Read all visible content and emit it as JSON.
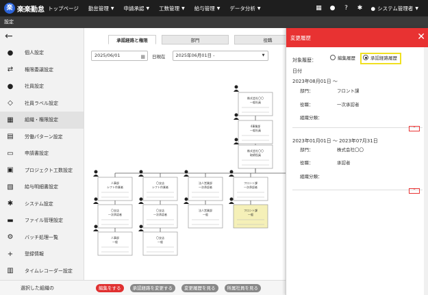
{
  "app": {
    "logo_mark": "楽",
    "logo_text": "楽楽勤怠",
    "menu": [
      {
        "label": "トップページ",
        "has_dropdown": false
      },
      {
        "label": "勤怠管理",
        "has_dropdown": true
      },
      {
        "label": "申請承認",
        "has_dropdown": true
      },
      {
        "label": "工数管理",
        "has_dropdown": true
      },
      {
        "label": "給与管理",
        "has_dropdown": true
      },
      {
        "label": "データ分析",
        "has_dropdown": true
      }
    ],
    "user_label": "システム管理者"
  },
  "subbar": {
    "title": "設定"
  },
  "sidebar": {
    "items": [
      {
        "label": "個人設定",
        "icon": "person-icon",
        "glyph": "●"
      },
      {
        "label": "権限委譲設定",
        "icon": "transfer-icon",
        "glyph": "⇄"
      },
      {
        "label": "社員設定",
        "icon": "users-icon",
        "glyph": "●"
      },
      {
        "label": "社員ラベル設定",
        "icon": "tag-icon",
        "glyph": "◇"
      },
      {
        "label": "組織・権限設定",
        "icon": "org-icon",
        "glyph": "▦",
        "active": true
      },
      {
        "label": "労働パターン設定",
        "icon": "list-icon",
        "glyph": "▤"
      },
      {
        "label": "申請書設定",
        "icon": "form-icon",
        "glyph": "▭"
      },
      {
        "label": "プロジェクト工数設定",
        "icon": "inbox-icon",
        "glyph": "▣"
      },
      {
        "label": "給与明細書設定",
        "icon": "payslip-icon",
        "glyph": "▧"
      },
      {
        "label": "システム設定",
        "icon": "gear-icon",
        "glyph": "✱"
      },
      {
        "label": "ファイル管理設定",
        "icon": "folder-icon",
        "glyph": "▬"
      },
      {
        "label": "バッチ処理一覧",
        "icon": "batch-icon",
        "glyph": "⚙"
      },
      {
        "label": "登録情報",
        "icon": "plus-icon",
        "glyph": "+"
      },
      {
        "label": "タイムレコーダー設定",
        "icon": "clipboard-icon",
        "glyph": "▥"
      }
    ]
  },
  "main": {
    "tabs": [
      {
        "label": "承認経路と権限",
        "active": true
      },
      {
        "label": "部門",
        "active": false
      },
      {
        "label": "役職",
        "active": false
      }
    ],
    "date_value": "2025/06/01",
    "as_of_label": "日現在",
    "period_value": "2025年06月01日 -"
  },
  "org_chart": {
    "top": {
      "line1": "株式会社〇〇",
      "line2": "一般社員"
    },
    "second": {
      "line1": "4事業部",
      "line2": "一般社員"
    },
    "third": {
      "line1": "株式会社〇〇",
      "line2": "取締役員"
    },
    "row1": [
      {
        "line1": "人事部",
        "line2": "シフト作業者"
      },
      {
        "line1": "〇支店",
        "line2": "シフト作業者"
      },
      {
        "line1": "法人営業部",
        "line2": "一次承認者"
      },
      {
        "line1": "フロント課",
        "line2": "一次承認者"
      }
    ],
    "row2": [
      {
        "line1": "〇支店",
        "line2": "一次承認者"
      },
      {
        "line1": "〇支店",
        "line2": "一次承認者"
      },
      {
        "line1": "法人営業部",
        "line2": "一般"
      },
      {
        "line1": "フロント課",
        "line2": "一般",
        "highlight": true
      }
    ],
    "row3": [
      {
        "line1": "人事部",
        "line2": "一般"
      },
      {
        "line1": "〇支店",
        "line2": "一般"
      }
    ]
  },
  "bottombar": {
    "label": "選択した組織の",
    "buttons": [
      {
        "label": "編集をする",
        "style": "red"
      },
      {
        "label": "承認経路を変更する",
        "style": "gray"
      },
      {
        "label": "変更履歴を見る",
        "style": "gray"
      },
      {
        "label": "所属社員を見る",
        "style": "gray"
      }
    ]
  },
  "panel": {
    "title": "変更履歴",
    "target_label": "対象履歴：",
    "radio_options": [
      {
        "label": "編集履歴",
        "selected": false
      },
      {
        "label": "承認経路履歴",
        "selected": true
      }
    ],
    "date_label": "日付",
    "entries": [
      {
        "period": "2023年08月01日 ～",
        "department_label": "部門：",
        "department": "フロント課",
        "position_label": "役職：",
        "position": "一次承認者",
        "category_label": "組織分類："
      },
      {
        "period": "2023年01月01日 ～ 2023年07月31日",
        "department_label": "部門：",
        "department": "株式会社〇〇",
        "position_label": "役職：",
        "position": "承認者",
        "category_label": "組織分類："
      }
    ]
  }
}
